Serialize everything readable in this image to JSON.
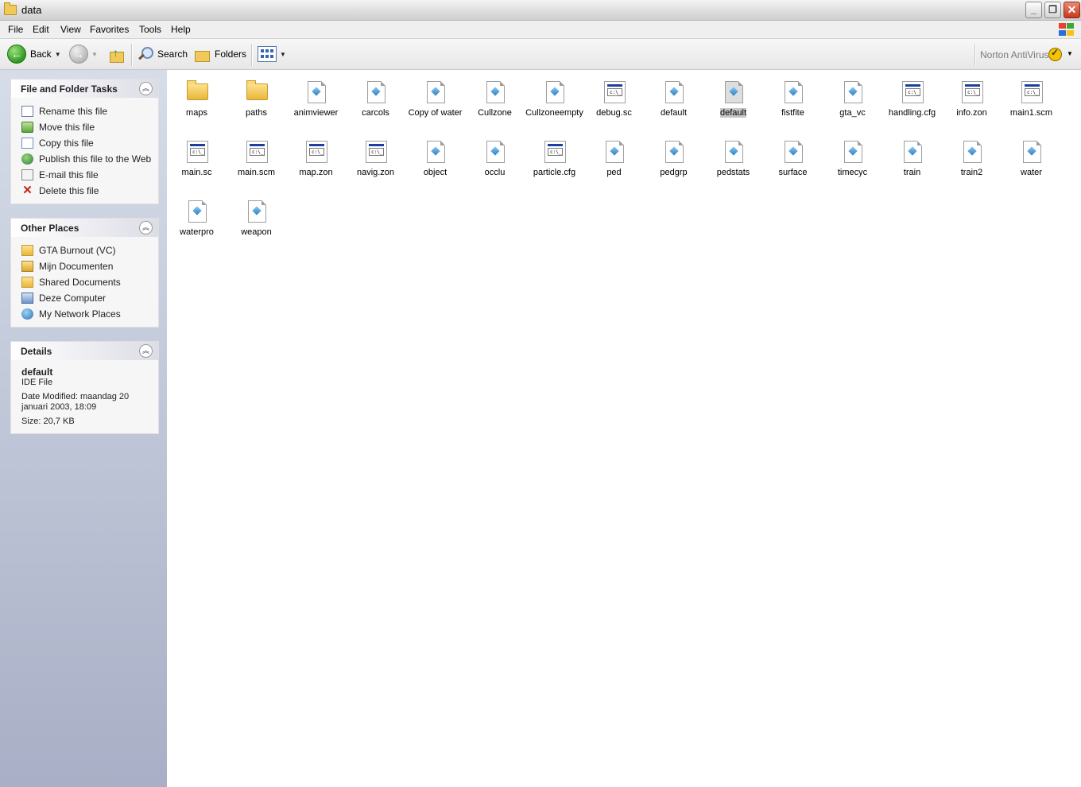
{
  "window": {
    "title": "data"
  },
  "menu": [
    "File",
    "Edit",
    "View",
    "Favorites",
    "Tools",
    "Help"
  ],
  "toolbar": {
    "back_label": "Back",
    "search_label": "Search",
    "folders_label": "Folders",
    "norton_label": "Norton AntiVirus"
  },
  "tasks": {
    "title": "File and Folder Tasks",
    "items": [
      {
        "label": "Rename this file",
        "icon": "rename-icon"
      },
      {
        "label": "Move this file",
        "icon": "move-icon"
      },
      {
        "label": "Copy this file",
        "icon": "copy-icon"
      },
      {
        "label": "Publish this file to the Web",
        "icon": "publish-web-icon"
      },
      {
        "label": "E-mail this file",
        "icon": "email-icon"
      },
      {
        "label": "Delete this file",
        "icon": "delete-icon"
      }
    ]
  },
  "places": {
    "title": "Other Places",
    "items": [
      {
        "label": "GTA Burnout (VC)",
        "icon": "folder-icon"
      },
      {
        "label": "Mijn Documenten",
        "icon": "documents-icon"
      },
      {
        "label": "Shared Documents",
        "icon": "folder-icon"
      },
      {
        "label": "Deze Computer",
        "icon": "computer-icon"
      },
      {
        "label": "My Network Places",
        "icon": "network-icon"
      }
    ]
  },
  "details": {
    "title": "Details",
    "name": "default",
    "type": "IDE File",
    "modified": "Date Modified: maandag 20 januari 2003, 18:09",
    "size": "Size: 20,7 KB"
  },
  "files": [
    {
      "name": "maps",
      "kind": "folder"
    },
    {
      "name": "paths",
      "kind": "folder"
    },
    {
      "name": "animviewer",
      "kind": "doc"
    },
    {
      "name": "carcols",
      "kind": "doc"
    },
    {
      "name": "Copy of water",
      "kind": "doc"
    },
    {
      "name": "Cullzone",
      "kind": "doc"
    },
    {
      "name": "Cullzoneempty",
      "kind": "doc"
    },
    {
      "name": "debug.sc",
      "kind": "prog"
    },
    {
      "name": "default",
      "kind": "doc"
    },
    {
      "name": "default",
      "kind": "doc",
      "selected": true
    },
    {
      "name": "fistfite",
      "kind": "doc"
    },
    {
      "name": "gta_vc",
      "kind": "doc"
    },
    {
      "name": "handling.cfg",
      "kind": "prog"
    },
    {
      "name": "info.zon",
      "kind": "prog"
    },
    {
      "name": "main1.scm",
      "kind": "prog"
    },
    {
      "name": "main.sc",
      "kind": "prog"
    },
    {
      "name": "main.scm",
      "kind": "prog"
    },
    {
      "name": "map.zon",
      "kind": "prog"
    },
    {
      "name": "navig.zon",
      "kind": "prog"
    },
    {
      "name": "object",
      "kind": "doc"
    },
    {
      "name": "occlu",
      "kind": "doc"
    },
    {
      "name": "particle.cfg",
      "kind": "prog"
    },
    {
      "name": "ped",
      "kind": "doc"
    },
    {
      "name": "pedgrp",
      "kind": "doc"
    },
    {
      "name": "pedstats",
      "kind": "doc"
    },
    {
      "name": "surface",
      "kind": "doc"
    },
    {
      "name": "timecyc",
      "kind": "doc"
    },
    {
      "name": "train",
      "kind": "doc"
    },
    {
      "name": "train2",
      "kind": "doc"
    },
    {
      "name": "water",
      "kind": "doc"
    },
    {
      "name": "waterpro",
      "kind": "doc"
    },
    {
      "name": "weapon",
      "kind": "doc"
    }
  ]
}
